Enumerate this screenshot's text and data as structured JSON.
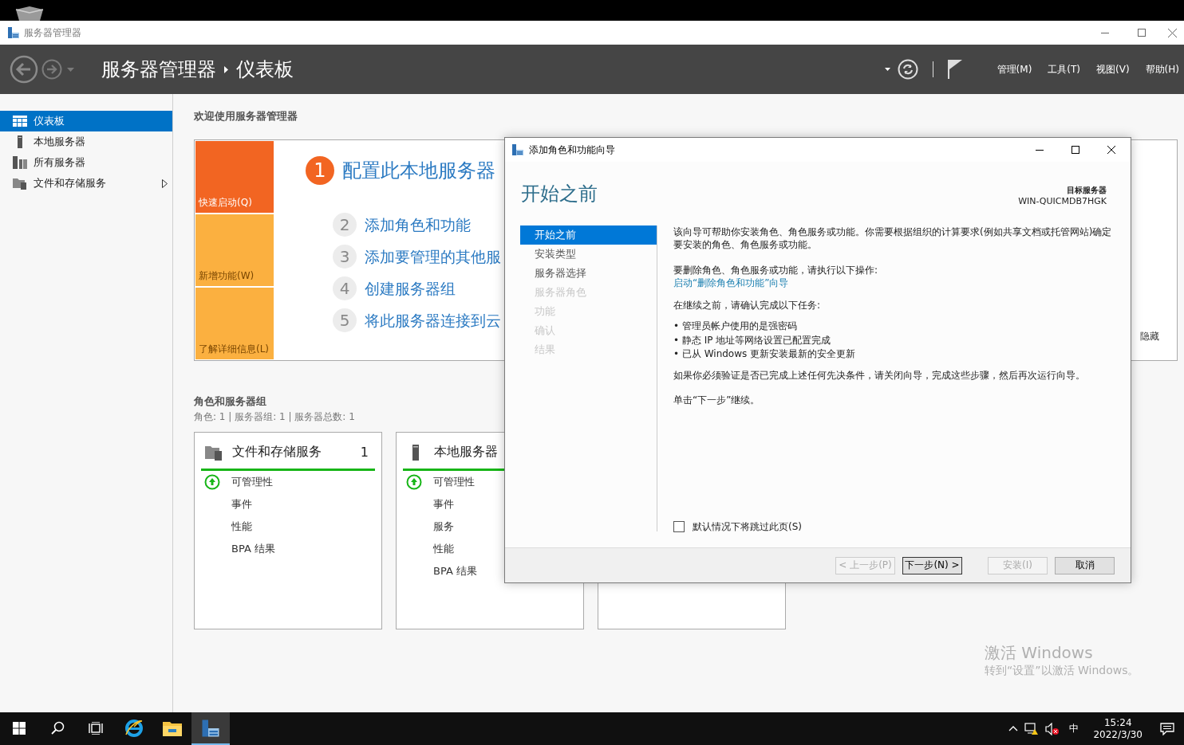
{
  "app": {
    "title": "服务器管理器"
  },
  "nav": {
    "breadcrumb": [
      "服务器管理器",
      "仪表板"
    ],
    "menus": [
      "管理(M)",
      "工具(T)",
      "视图(V)",
      "帮助(H)"
    ]
  },
  "sidebar": {
    "items": [
      {
        "label": "仪表板",
        "kind": "dashboard",
        "selected": true,
        "expandable": false
      },
      {
        "label": "本地服务器",
        "kind": "server",
        "selected": false,
        "expandable": false
      },
      {
        "label": "所有服务器",
        "kind": "servers",
        "selected": false,
        "expandable": false
      },
      {
        "label": "文件和存储服务",
        "kind": "storage",
        "selected": false,
        "expandable": true
      }
    ]
  },
  "welcome": {
    "heading": "欢迎使用服务器管理器",
    "tiles": [
      {
        "label": "快速启动(Q)",
        "active": true
      },
      {
        "label": "新增功能(W)",
        "active": false
      },
      {
        "label": "了解详细信息(L)",
        "active": false
      }
    ],
    "steps": [
      {
        "number": "1",
        "label": "配置此本地服务器",
        "kind": "primary"
      },
      {
        "number": "2",
        "label": "添加角色和功能",
        "kind": "secondary"
      },
      {
        "number": "3",
        "label": "添加要管理的其他服",
        "kind": "secondary"
      },
      {
        "number": "4",
        "label": "创建服务器组",
        "kind": "secondary"
      },
      {
        "number": "5",
        "label": "将此服务器连接到云",
        "kind": "secondary"
      }
    ],
    "hide": "隐藏"
  },
  "roles": {
    "heading": "角色和服务器组",
    "summary": "角色: 1 | 服务器组: 1 | 服务器总数: 1",
    "cards": [
      {
        "title": "文件和存储服务",
        "kind": "storage",
        "count": "1",
        "items": [
          {
            "label": "可管理性",
            "healthy": true
          },
          {
            "label": "事件",
            "healthy": false
          },
          {
            "label": "性能",
            "healthy": false
          },
          {
            "label": "BPA 结果",
            "healthy": false
          }
        ]
      },
      {
        "title": "本地服务器",
        "kind": "server",
        "items": [
          {
            "label": "可管理性",
            "healthy": true
          },
          {
            "label": "事件",
            "healthy": false
          },
          {
            "label": "服务",
            "healthy": false
          },
          {
            "label": "性能",
            "healthy": false
          },
          {
            "label": "BPA 结果",
            "healthy": false
          }
        ]
      },
      {
        "kind": "blank"
      }
    ]
  },
  "wizard": {
    "title": "添加角色和功能向导",
    "heading": "开始之前",
    "target_label": "目标服务器",
    "target_server": "WIN-QUICMDB7HGK",
    "steps": [
      {
        "label": "开始之前",
        "selected": true,
        "disabled": false
      },
      {
        "label": "安装类型",
        "selected": false,
        "disabled": false
      },
      {
        "label": "服务器选择",
        "selected": false,
        "disabled": false
      },
      {
        "label": "服务器角色",
        "selected": false,
        "disabled": true
      },
      {
        "label": "功能",
        "selected": false,
        "disabled": true
      },
      {
        "label": "确认",
        "selected": false,
        "disabled": true
      },
      {
        "label": "结果",
        "selected": false,
        "disabled": true
      }
    ],
    "intro": "该向导可帮助你安装角色、角色服务或功能。你需要根据组织的计算要求(例如共享文档或托管网站)确定要安装的角色、角色服务或功能。",
    "remove_text": "要删除角色、角色服务或功能，请执行以下操作:",
    "remove_link": "启动“删除角色和功能”向导",
    "tasks_intro": "在继续之前，请确认完成以下任务:",
    "tasks": [
      "• 管理员帐户使用的是强密码",
      "• 静态 IP 地址等网络设置已配置完成",
      "• 已从 Windows 更新安装最新的安全更新"
    ],
    "note": "如果你必须验证是否已完成上述任何先决条件，请关闭向导，完成这些步骤，然后再次运行向导。",
    "continue_text": "单击“下一步”继续。",
    "skip": {
      "label": "默认情况下将跳过此页(S)",
      "checked": false
    },
    "buttons": [
      {
        "label": "< 上一步(P)",
        "disabled": true,
        "focused": false
      },
      {
        "label": "下一步(N) >",
        "disabled": false,
        "focused": true
      },
      {
        "label": "安装(I)",
        "disabled": true,
        "focused": false
      },
      {
        "label": "取消",
        "disabled": false,
        "focused": false
      }
    ]
  },
  "taskbar": {
    "apps": [
      {
        "kind": "ie",
        "active": false
      },
      {
        "kind": "explorer",
        "active": false
      },
      {
        "kind": "server-manager",
        "active": true
      }
    ],
    "ime": "中",
    "time": "15:24",
    "date": "2022/3/30"
  },
  "activation": {
    "title": "激活 Windows",
    "subtitle": "转到“设置”以激活 Windows。"
  }
}
